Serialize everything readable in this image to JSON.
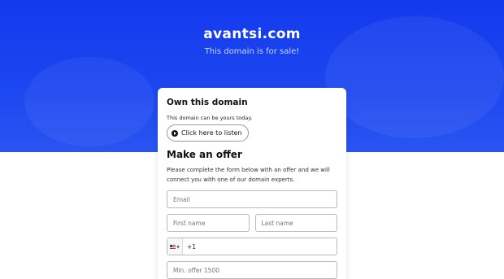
{
  "header": {
    "domain": "avantsi.com",
    "subtitle": "This domain is for sale!"
  },
  "own": {
    "title": "Own this domain",
    "text": "This domain can be yours today.",
    "listen_label": "Click here to listen"
  },
  "offer": {
    "title": "Make an offer",
    "text": "Please complete the form below with an offer and we will connect you with one of our domain experts.",
    "email_placeholder": "Email",
    "first_name_placeholder": "First name",
    "last_name_placeholder": "Last name",
    "dial_code": "+1",
    "offer_placeholder": "Min. offer 1500"
  },
  "colors": {
    "hero_blue": "#1d47f0"
  },
  "icons": {
    "play": "play-circle-icon",
    "flag": "us-flag-icon"
  }
}
